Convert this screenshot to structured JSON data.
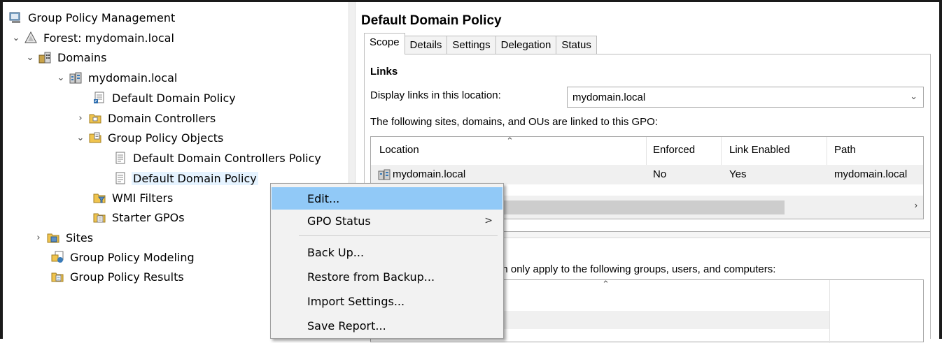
{
  "tree": {
    "root": "Group Policy Management",
    "forest": "Forest: mydomain.local",
    "domains": "Domains",
    "domain": "mydomain.local",
    "default_domain_policy_link": "Default Domain Policy",
    "domain_controllers": "Domain Controllers",
    "group_policy_objects": "Group Policy Objects",
    "gpo_dc_policy": "Default Domain Controllers Policy",
    "gpo_default_policy": "Default Domain Policy",
    "wmi_filters": "WMI Filters",
    "starter_gpos": "Starter GPOs",
    "sites": "Sites",
    "modeling": "Group Policy Modeling",
    "results": "Group Policy Results"
  },
  "panel": {
    "title": "Default Domain Policy",
    "tabs": [
      "Scope",
      "Details",
      "Settings",
      "Delegation",
      "Status"
    ],
    "links_heading": "Links",
    "display_links_label": "Display links in this location:",
    "location_value": "mydomain.local",
    "linked_text": "The following sites, domains, and OUs are linked to this GPO:",
    "columns": [
      "Location",
      "Enforced",
      "Link Enabled",
      "Path"
    ],
    "row": {
      "location": "mydomain.local",
      "enforced": "No",
      "link_enabled": "Yes",
      "path": "mydomain.local"
    },
    "filter_text": "an only apply to the following groups, users, and computers:"
  },
  "context_menu": {
    "items": [
      "Edit...",
      "GPO Status",
      "Back Up...",
      "Restore from Backup...",
      "Import Settings...",
      "Save Report..."
    ],
    "submenu_arrow": ">"
  },
  "icons": {
    "chevron_expanded": "chevron-down-icon",
    "chevron_collapsed": "chevron-right-icon"
  }
}
